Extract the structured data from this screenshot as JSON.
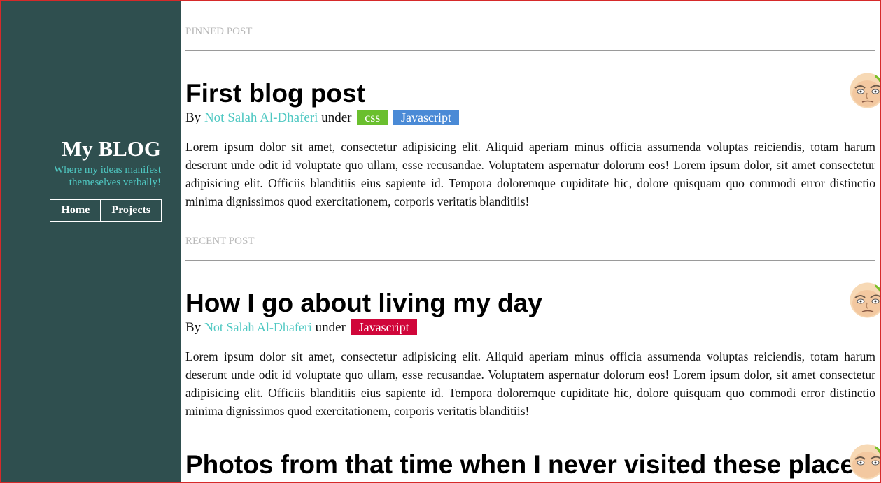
{
  "sidebar": {
    "title": "My BLOG",
    "tagline_line1": "Where my ideas manifest",
    "tagline_line2": "themeselves verbally!",
    "nav": [
      {
        "label": "Home"
      },
      {
        "label": "Projects"
      }
    ]
  },
  "sections": {
    "pinned_label": "PINNED POST",
    "recent_label": "RECENT POST"
  },
  "posts": [
    {
      "title": "First blog post",
      "by": "By",
      "author": "Not Salah Al-Dhaferi",
      "under": "under",
      "tags": [
        {
          "label": "css",
          "color": "#6abf2e"
        },
        {
          "label": "Javascript",
          "color": "#4a8ad6"
        }
      ],
      "body": "Lorem ipsum dolor sit amet, consectetur adipisicing elit. Aliquid aperiam minus officia assumenda voluptas reiciendis, totam harum deserunt unde odit id voluptate quo ullam, esse recusandae. Voluptatem aspernatur dolorum eos! Lorem ipsum dolor, sit amet consectetur adipisicing elit. Officiis blanditiis eius sapiente id. Tempora doloremque cupiditate hic, dolore quisquam quo commodi error distinctio minima dignissimos quod exercitationem, corporis veritatis blanditiis!"
    },
    {
      "title": "How I go about living my day",
      "by": "By",
      "author": "Not Salah Al-Dhaferi",
      "under": "under",
      "tags": [
        {
          "label": "Javascript",
          "color": "#d0063a"
        }
      ],
      "body": "Lorem ipsum dolor sit amet, consectetur adipisicing elit. Aliquid aperiam minus officia assumenda voluptas reiciendis, totam harum deserunt unde odit id voluptate quo ullam, esse recusandae. Voluptatem aspernatur dolorum eos! Lorem ipsum dolor, sit amet consectetur adipisicing elit. Officiis blanditiis eius sapiente id. Tempora doloremque cupiditate hic, dolore quisquam quo commodi error distinctio minima dignissimos quod exercitationem, corporis veritatis blanditiis!"
    },
    {
      "title": "Photos from that time when I never visited these places"
    }
  ],
  "colors": {
    "sidebar_bg": "#2f4f4f",
    "accent": "#4fc8c2",
    "frame_border": "#d62a2a"
  },
  "icons": {
    "avatar": "avatar-cartoon-face"
  }
}
